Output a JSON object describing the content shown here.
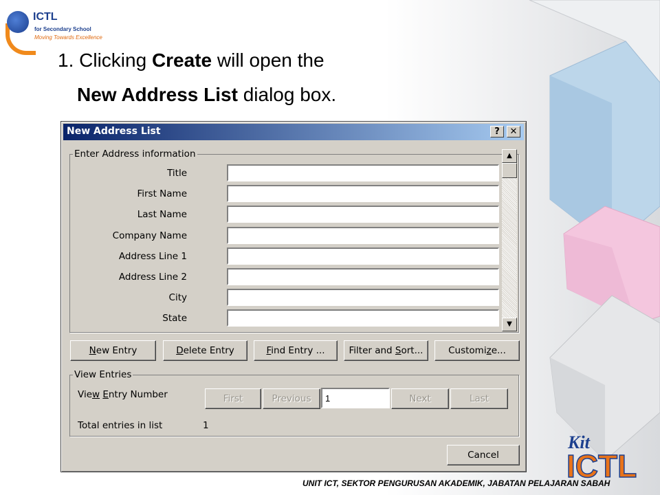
{
  "logo": {
    "title": "ICTL",
    "subtitle": "for Secondary School",
    "tagline": "Moving Towards Excellence"
  },
  "heading": {
    "line1_prefix": "1. Clicking ",
    "line1_bold": "Create",
    "line1_suffix": " will open the",
    "line2_bold": "New Address List",
    "line2_suffix": " dialog box."
  },
  "dialog": {
    "title": "New Address List",
    "help_button": "?",
    "close_button": "✕",
    "address_group": {
      "legend": "Enter Address information",
      "fields": [
        {
          "label": "Title",
          "value": ""
        },
        {
          "label": "First Name",
          "value": ""
        },
        {
          "label": "Last Name",
          "value": ""
        },
        {
          "label": "Company Name",
          "value": ""
        },
        {
          "label": "Address Line 1",
          "value": ""
        },
        {
          "label": "Address Line 2",
          "value": ""
        },
        {
          "label": "City",
          "value": ""
        },
        {
          "label": "State",
          "value": ""
        }
      ]
    },
    "buttons": {
      "new_entry": "New Entry",
      "delete_entry": "Delete Entry",
      "find_entry": "Find Entry ...",
      "filter_sort": "Filter and Sort...",
      "customize": "Customize..."
    },
    "view_group": {
      "legend": "View Entries",
      "entry_label": "View Entry Number",
      "first": "First",
      "previous": "Previous",
      "entry_number": "1",
      "next": "Next",
      "last": "Last",
      "total_label": "Total entries in list",
      "total_value": "1"
    },
    "cancel": "Cancel"
  },
  "footer": "UNIT ICT, SEKTOR PENGURUSAN AKADEMIK, JABATAN PELAJARAN SABAH",
  "kit_logo": {
    "top": "Kit",
    "main": "ICTL"
  },
  "colors": {
    "titlebar_start": "#0a246a",
    "titlebar_end": "#a6caf0",
    "dialog_face": "#d4d0c8",
    "accent_orange": "#f08a1c"
  }
}
